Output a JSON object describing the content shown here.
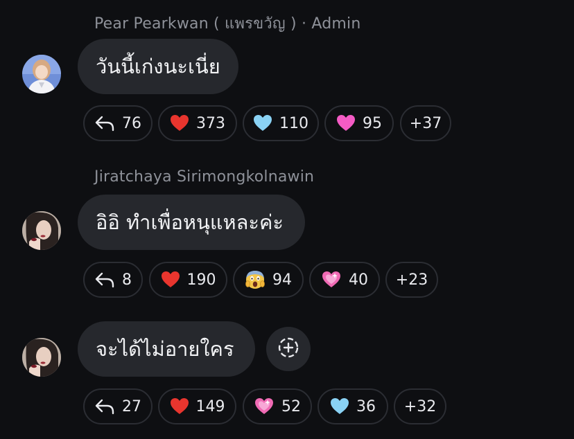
{
  "messages": [
    {
      "author": "Pear Pearkwan ( แพรขวัญ ) · Admin",
      "text": "วันนี้เก่งนะเนี่ย",
      "reactions": {
        "reply_count": "76",
        "items": [
          {
            "icon": "red-heart-icon",
            "count": "373"
          },
          {
            "icon": "blue-heart-icon",
            "count": "110"
          },
          {
            "icon": "pink-heart-icon",
            "count": "95"
          }
        ],
        "more": "+37"
      }
    },
    {
      "author": "Jiratchaya Sirimongkolnawin",
      "text": "อิอิ ทำเพื่อหนุแหละค่ะ",
      "reactions": {
        "reply_count": "8",
        "items": [
          {
            "icon": "red-heart-icon",
            "count": "190"
          },
          {
            "icon": "screaming-face-icon",
            "count": "94"
          },
          {
            "icon": "sparkling-heart-icon",
            "count": "40"
          }
        ],
        "more": "+23"
      }
    },
    {
      "author": "",
      "text": "จะได้ไม่อายใคร",
      "reactions": {
        "reply_count": "27",
        "items": [
          {
            "icon": "red-heart-icon",
            "count": "149"
          },
          {
            "icon": "sparkling-heart-icon",
            "count": "52"
          },
          {
            "icon": "blue-heart-icon",
            "count": "36"
          }
        ],
        "more": "+32"
      }
    }
  ],
  "colors": {
    "background": "#0e0f12",
    "bubble": "#26282d",
    "author_text": "#8e9199",
    "pill_border": "#2b2d33"
  }
}
